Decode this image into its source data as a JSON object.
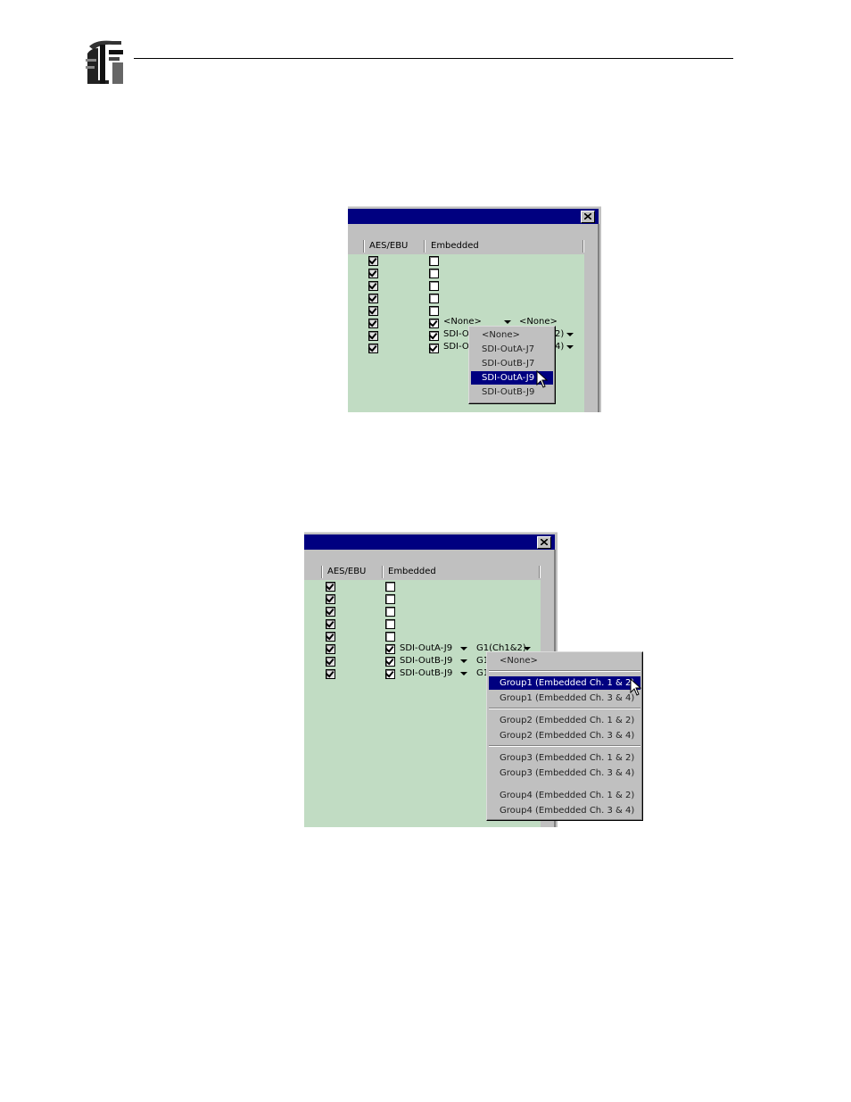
{
  "header": {
    "logo_icon": "company-logo-icon"
  },
  "screenshot1": {
    "columns": {
      "aes_ebu": "AES/EBU",
      "embedded": "Embedded"
    },
    "row_labels": [
      {
        "output": "<None>",
        "group": "<None>"
      },
      {
        "output": "SDI-O",
        "group": "2)"
      },
      {
        "output": "SDI-O",
        "group": "4)"
      }
    ],
    "dropdown": {
      "items": [
        "<None>",
        "SDI-OutA-J7",
        "SDI-OutB-J7",
        "SDI-OutA-J9",
        "SDI-OutB-J9"
      ],
      "selected": "SDI-OutA-J9"
    }
  },
  "screenshot2": {
    "columns": {
      "aes_ebu": "AES/EBU",
      "embedded": "Embedded"
    },
    "row_labels": [
      {
        "output": "SDI-OutA-J9",
        "group": "G1(Ch1&2)"
      },
      {
        "output": "SDI-OutB-J9",
        "group": "G1"
      },
      {
        "output": "SDI-OutB-J9",
        "group": "G1"
      }
    ],
    "dropdown": {
      "items": [
        "<None>",
        "Group1 (Embedded Ch. 1 & 2)",
        "Group1 (Embedded Ch. 3 & 4)",
        "Group2 (Embedded Ch. 1 & 2)",
        "Group2 (Embedded Ch. 3 & 4)",
        "Group3 (Embedded Ch. 1 & 2)",
        "Group3 (Embedded Ch. 3 & 4)",
        "Group4 (Embedded Ch. 1 & 2)",
        "Group4 (Embedded Ch. 3 & 4)"
      ],
      "selected": "Group1 (Embedded Ch. 1 & 2)"
    }
  },
  "colors": {
    "titlebar": "#000080",
    "panel_green": "#c1dcc3",
    "selection": "#000080",
    "window_gray": "#c0c0c0"
  }
}
